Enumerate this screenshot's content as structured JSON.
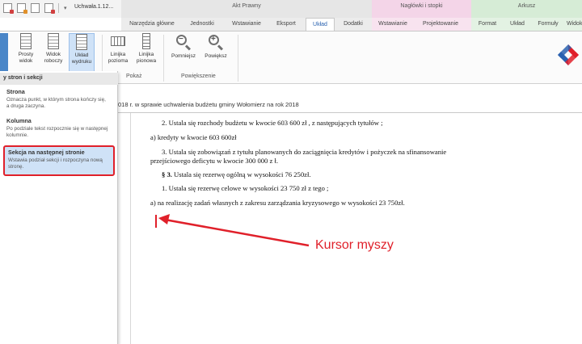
{
  "window": {
    "document_title": "Uchwała.1.12...",
    "qat_dropdown": "▾"
  },
  "context_groups": {
    "akt_prawny": "Akt Prawny",
    "naglowki": "Nagłówki i stopki",
    "arkusz": "Arkusz"
  },
  "tabs": [
    {
      "label": "Narzędzia główne"
    },
    {
      "label": "Jednostki"
    },
    {
      "label": "Wstawianie"
    },
    {
      "label": "Eksport"
    },
    {
      "label": "Układ"
    },
    {
      "label": "Dodatki"
    },
    {
      "label": "Wstawianie"
    },
    {
      "label": "Projektowanie"
    },
    {
      "label": "Format"
    },
    {
      "label": "Układ"
    },
    {
      "label": "Formuły"
    },
    {
      "label": "Widok"
    }
  ],
  "ribbon": {
    "buttons": {
      "prosty_widok": "Prosty widok",
      "widok_roboczy": "Widok roboczy",
      "uklad_wydruku": "Układ wydruku",
      "linijka_pozioma": "Linijka pozioma",
      "linijka_pionowa": "Linijka pionowa",
      "pomniejsz": "Pomniejsz",
      "powieksz": "Powiększ"
    },
    "groups": {
      "pokaz": "Pokaż",
      "powiekszenie": "Powiększenie"
    }
  },
  "dropdown": {
    "header": "y stron i sekcji",
    "items": [
      {
        "title": "Strona",
        "desc": "Oznacza punkt, w którym strona kończy się, a druga zaczyna."
      },
      {
        "title": "Kolumna",
        "desc": "Po podziale tekst rozpocznie się w następnej kolumnie."
      },
      {
        "title": "Sekcja na następnej stronie",
        "desc": "Wstawia podział sekcji i rozpoczyna nową stronę."
      }
    ]
  },
  "breadcrumb": "018 r. w sprawie uchwalenia budżetu gminy Wołomierz na rok 2018",
  "document": {
    "lines": [
      "2. Ustala się  rozchody budżetu w kwocie 603 600 zł , z następujących tytułów ;",
      "a) kredyty w kwocie 603 600zł",
      "3. Ustala się zobowiązań z tytułu planowanych do zaciągnięcia kredytów i pożyczek na  sfinansowanie",
      "przejściowego deficytu w kwocie 300 000 z ł.",
      "§ 3. Ustala się  rezerwę ogólną w wysokości 76 250zł.",
      "1. Ustala się  rezerwę celowe w wysokości 23 750 zł z tego ;",
      "a) na realizację zadań własnych z zakresu zarządzania kryzysowego w wysokości 23 750zł."
    ],
    "bold_prefix_par3": "§ 3.",
    "par3_rest": " Ustala się  rezerwę ogólną w wysokości 76 250zł."
  },
  "annotation": {
    "callout": "Kursor myszy",
    "color": "#e0202a"
  }
}
